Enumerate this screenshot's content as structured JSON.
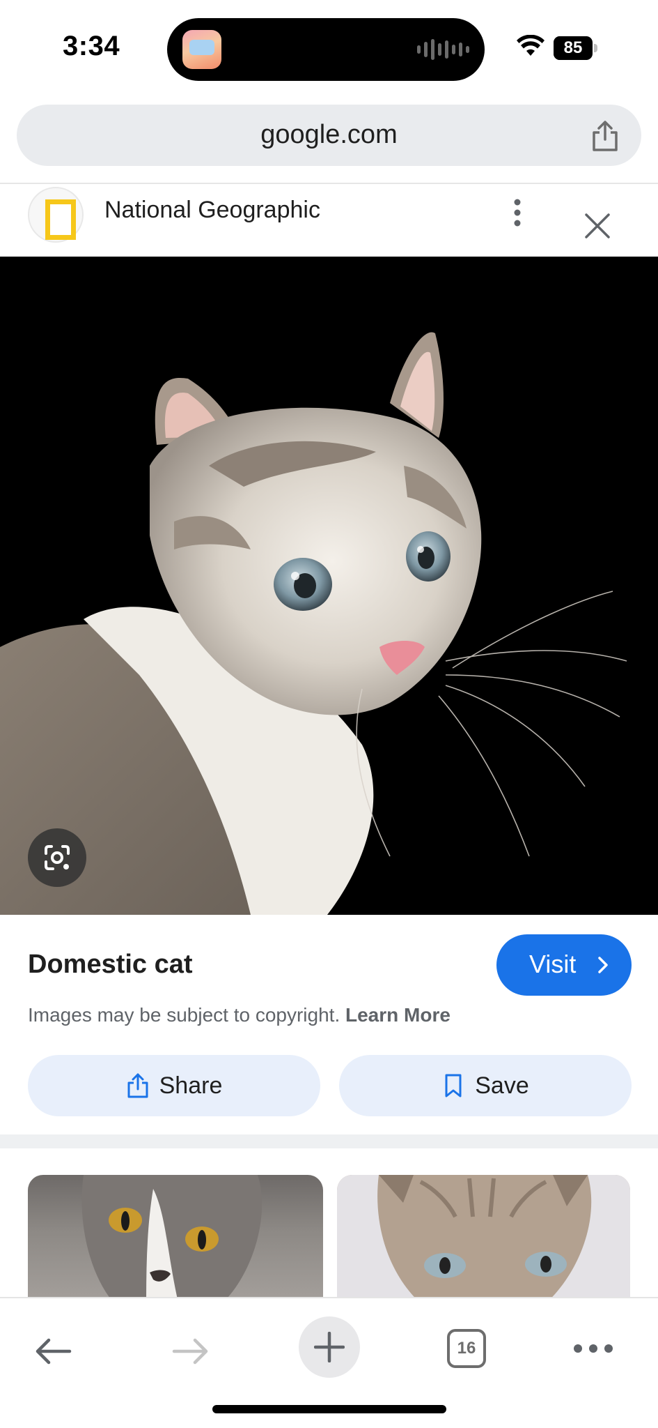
{
  "status_bar": {
    "time": "3:34",
    "battery_level": "85",
    "battery_fraction": 0.85
  },
  "browser": {
    "url": "google.com"
  },
  "source": {
    "name": "National Geographic"
  },
  "image": {
    "title": "Domestic cat",
    "visit_label": "Visit",
    "copyright_text": "Images may be subject to copyright.",
    "learn_more_label": "Learn More"
  },
  "actions": {
    "share_label": "Share",
    "save_label": "Save"
  },
  "toolbar": {
    "tab_count": "16"
  },
  "colors": {
    "accent": "#1a73e8",
    "action_bg": "#e8effb",
    "url_bar_bg": "#e9ebee",
    "logo_yellow": "#f6c71a"
  },
  "icons": {
    "status_wifi": "wifi-icon",
    "battery": "battery-icon",
    "url_share": "share-icon",
    "menu": "more-vert-icon",
    "close": "close-icon",
    "lens": "google-lens-icon",
    "visit": "chevron-right-icon",
    "share": "share-icon",
    "save": "bookmark-icon",
    "back": "arrow-left-icon",
    "forward": "arrow-right-icon",
    "new_tab": "plus-icon",
    "tabs": "tab-switcher-icon",
    "more": "more-horiz-icon"
  }
}
